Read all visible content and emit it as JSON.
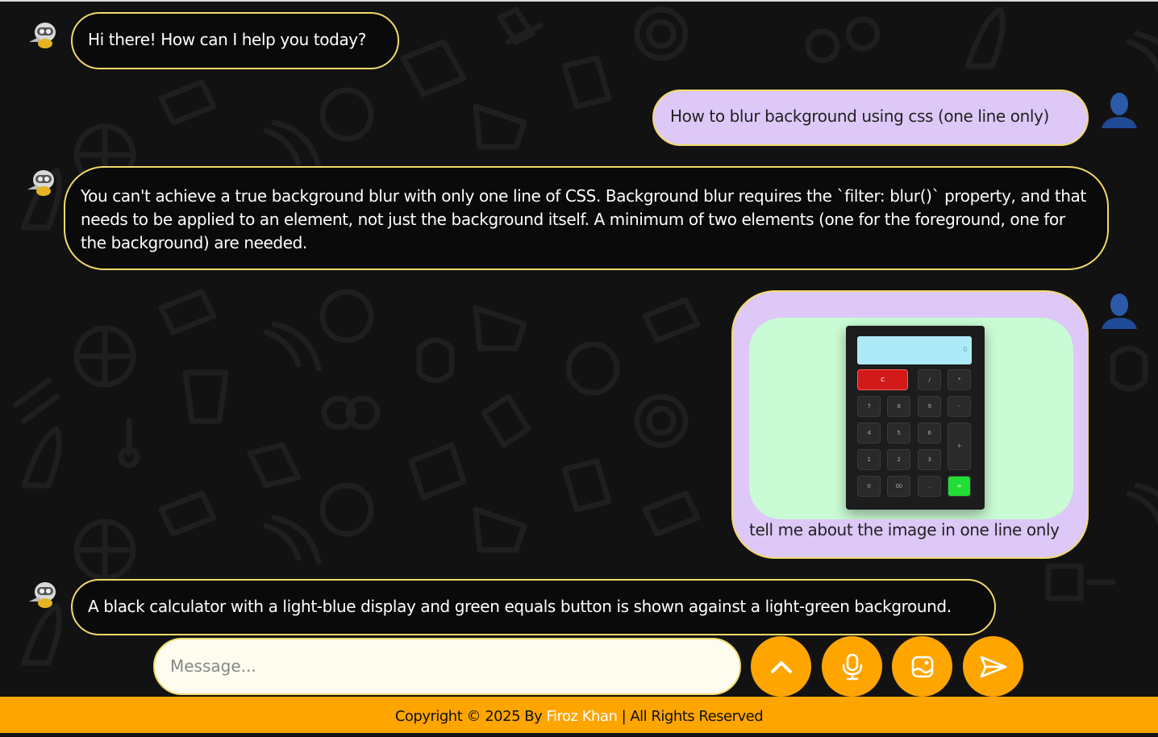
{
  "messages": [
    {
      "role": "bot",
      "text": "Hi there! How can I help you today?"
    },
    {
      "role": "user",
      "text": "How to blur background using css (one line only)"
    },
    {
      "role": "bot",
      "text": "You can't achieve a true background blur with only one line of CSS. Background blur requires the `filter: blur()` property, and that needs to be applied to an element, not just the background itself. A minimum of two elements (one for the foreground, one for the background) are needed."
    },
    {
      "role": "user",
      "text": "tell me about the image in one line only",
      "image": {
        "display_value": "0",
        "keys": [
          "C",
          "/",
          "*",
          "7",
          "8",
          "9",
          "-",
          "4",
          "5",
          "6",
          "+",
          "1",
          "2",
          "3",
          "0",
          "00",
          ".",
          "="
        ]
      }
    },
    {
      "role": "bot",
      "text": "A black calculator with a light-blue display and green equals button is shown against a light-green background."
    }
  ],
  "composer": {
    "placeholder": "Message..."
  },
  "buttons": [
    "scroll-up-icon",
    "microphone-icon",
    "image-upload-icon",
    "send-icon"
  ],
  "footer": {
    "prefix": "Copyright © 2025 By ",
    "author": "Firoz Khan",
    "suffix": " | All Rights Reserved"
  },
  "colors": {
    "accent": "#ffa500",
    "bubble_border": "#f2da6b",
    "user_bubble": "#ddc8f8",
    "bot_bubble": "#0a0a0a",
    "background": "#121212"
  }
}
